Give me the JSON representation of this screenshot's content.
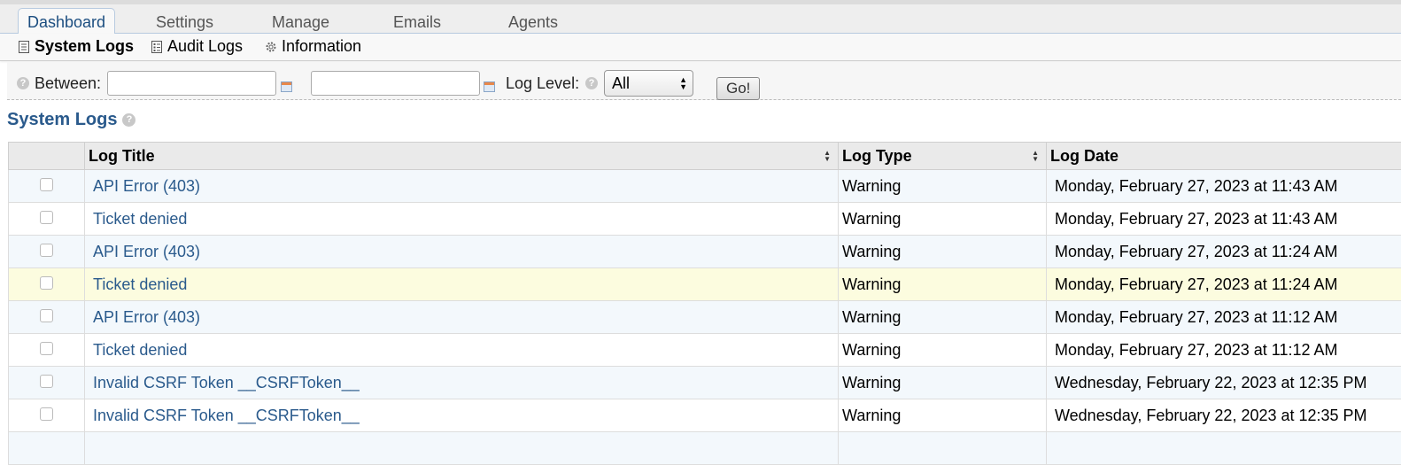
{
  "nav": {
    "tabs": [
      {
        "label": "Dashboard",
        "active": true
      },
      {
        "label": "Settings",
        "active": false
      },
      {
        "label": "Manage",
        "active": false
      },
      {
        "label": "Emails",
        "active": false
      },
      {
        "label": "Agents",
        "active": false
      }
    ]
  },
  "subnav": {
    "items": [
      {
        "label": "System Logs",
        "icon": "document-icon",
        "active": true
      },
      {
        "label": "Audit Logs",
        "icon": "list-icon",
        "active": false
      },
      {
        "label": "Information",
        "icon": "gear-icon",
        "active": false
      }
    ]
  },
  "filter": {
    "between_label": "Between:",
    "start_date": "",
    "end_date": "",
    "log_level_label": "Log Level:",
    "log_level_selected": "All",
    "go_label": "Go!"
  },
  "section": {
    "title": "System Logs"
  },
  "table": {
    "headers": [
      "Log Title",
      "Log Type",
      "Log Date"
    ],
    "rows": [
      {
        "title": "API Error (403)",
        "type": "Warning",
        "date": "Monday, February 27, 2023 at 11:43 AM"
      },
      {
        "title": "Ticket denied",
        "type": "Warning",
        "date": "Monday, February 27, 2023 at 11:43 AM"
      },
      {
        "title": "API Error (403)",
        "type": "Warning",
        "date": "Monday, February 27, 2023 at 11:24 AM"
      },
      {
        "title": "Ticket denied",
        "type": "Warning",
        "date": "Monday, February 27, 2023 at 11:24 AM"
      },
      {
        "title": "API Error (403)",
        "type": "Warning",
        "date": "Monday, February 27, 2023 at 11:12 AM"
      },
      {
        "title": "Ticket denied",
        "type": "Warning",
        "date": "Monday, February 27, 2023 at 11:12 AM"
      },
      {
        "title": "Invalid CSRF Token __CSRFToken__",
        "type": "Warning",
        "date": "Wednesday, February 22, 2023 at 12:35 PM"
      },
      {
        "title": "Invalid CSRF Token __CSRFToken__",
        "type": "Warning",
        "date": "Wednesday, February 22, 2023 at 12:35 PM"
      }
    ]
  },
  "colors": {
    "accent": "#2a5a8c",
    "row_alt": "#f3f8fc",
    "row_highlight": "#fcfcdf"
  }
}
